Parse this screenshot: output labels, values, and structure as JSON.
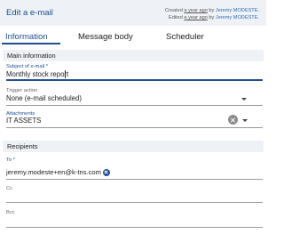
{
  "header": {
    "title": "Edit a e-mail",
    "created_prefix": "Created",
    "created_ago": "a year ago",
    "edited_prefix": "Edited",
    "edited_ago": "a year ago",
    "by_word": "by",
    "author": "Jeremy MODESTE."
  },
  "tabs": [
    {
      "label": "Information",
      "active": true
    },
    {
      "label": "Message body",
      "active": false
    },
    {
      "label": "Scheduler",
      "active": false
    }
  ],
  "main_information": {
    "section_title": "Main information",
    "subject": {
      "label": "Subject of e-mail *",
      "value": "Monthly stock report"
    },
    "trigger": {
      "label": "Trigger action",
      "value": "None (e-mail scheduled)"
    },
    "attachments": {
      "label": "Attachments",
      "value": "IT ASSETS"
    }
  },
  "recipients": {
    "section_title": "Recipients",
    "to": {
      "label": "To *",
      "chips": [
        "jeremy.modeste+en@k-tns.com"
      ]
    },
    "cc": {
      "label": "Cc",
      "value": ""
    },
    "bcc": {
      "label": "Bcc",
      "value": ""
    }
  },
  "colors": {
    "accent": "#1f4e91",
    "header_bg": "#eef1f5",
    "link": "#2f6db5"
  },
  "icons": [
    "clear-icon",
    "chevron-down-icon",
    "chip-remove-icon"
  ]
}
